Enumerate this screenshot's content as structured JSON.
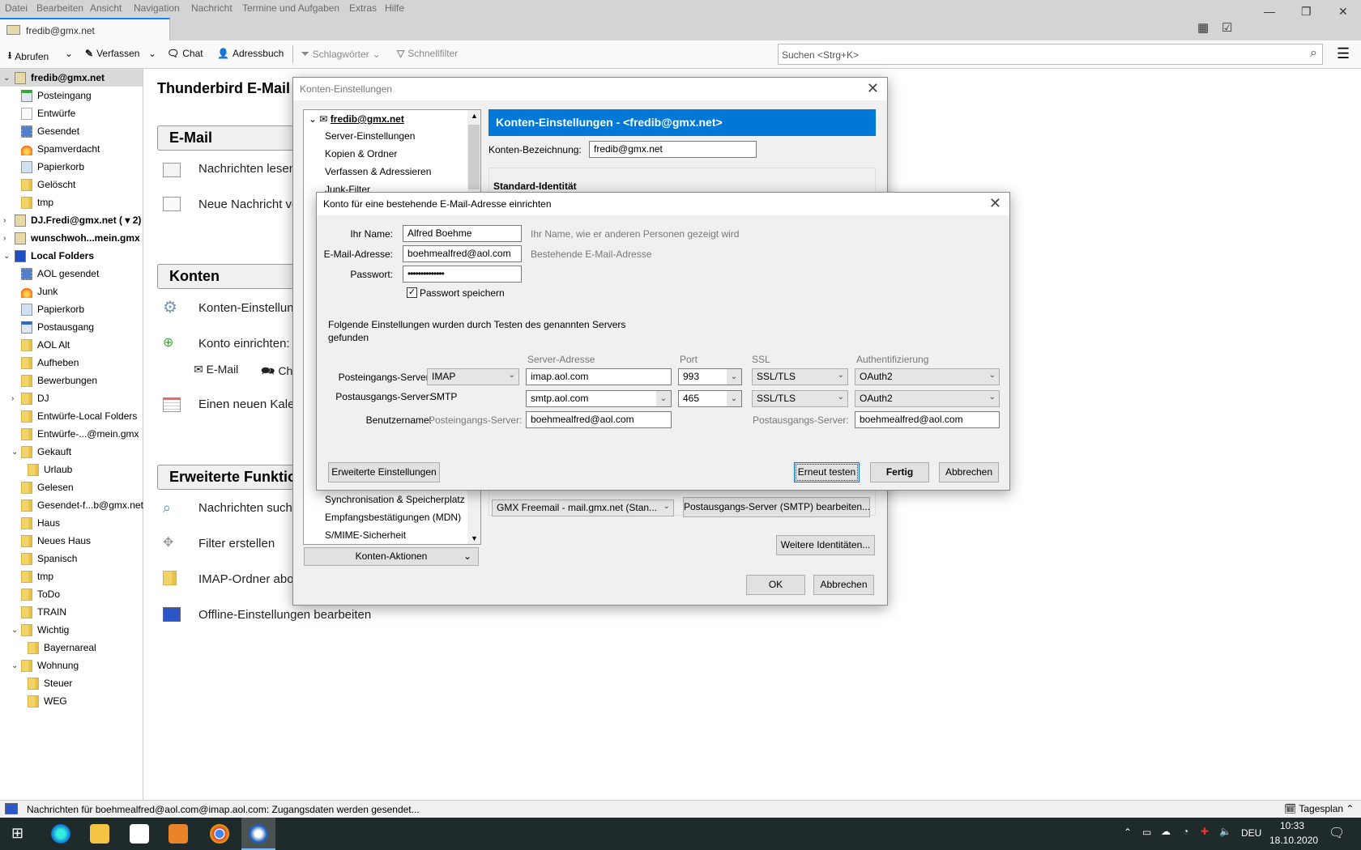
{
  "menu": [
    "Datei",
    "Bearbeiten",
    "Ansicht",
    "Navigation",
    "Nachricht",
    "Termine und Aufgaben",
    "Extras",
    "Hilfe"
  ],
  "tab": {
    "label": "fredib@gmx.net"
  },
  "toolbar": {
    "get": "Abrufen",
    "write": "Verfassen",
    "chat": "Chat",
    "addressbook": "Adressbuch",
    "tags": "Schlagwörter",
    "quickfilter": "Schnellfilter",
    "search_placeholder": "Suchen <Strg+K>"
  },
  "folders": [
    {
      "label": "fredib@gmx.net",
      "level": 0,
      "exp": "v",
      "icon": "account",
      "bold": true,
      "selected": true
    },
    {
      "label": "Posteingang",
      "level": 1,
      "icon": "inbox"
    },
    {
      "label": "Entwürfe",
      "level": 1,
      "icon": "drafts"
    },
    {
      "label": "Gesendet",
      "level": 1,
      "icon": "sent"
    },
    {
      "label": "Spamverdacht",
      "level": 1,
      "icon": "junk"
    },
    {
      "label": "Papierkorb",
      "level": 1,
      "icon": "trash"
    },
    {
      "label": "Gelöscht",
      "level": 1,
      "icon": "folder"
    },
    {
      "label": "tmp",
      "level": 1,
      "icon": "folder"
    },
    {
      "label": "DJ.Fredi@gmx.net ( ▾ 2)",
      "level": 0,
      "exp": ">",
      "icon": "account",
      "bold": true
    },
    {
      "label": "wunschwoh...mein.gmx",
      "level": 0,
      "exp": ">",
      "icon": "account",
      "bold": true
    },
    {
      "label": "Local Folders",
      "level": 0,
      "exp": "v",
      "icon": "computer",
      "bold": true
    },
    {
      "label": "AOL gesendet",
      "level": 1,
      "icon": "sent"
    },
    {
      "label": "Junk",
      "level": 1,
      "icon": "junk"
    },
    {
      "label": "Papierkorb",
      "level": 1,
      "icon": "trash"
    },
    {
      "label": "Postausgang",
      "level": 1,
      "icon": "outbox"
    },
    {
      "label": "AOL Alt",
      "level": 1,
      "icon": "folder"
    },
    {
      "label": "Aufheben",
      "level": 1,
      "icon": "folder"
    },
    {
      "label": "Bewerbungen",
      "level": 1,
      "icon": "folder"
    },
    {
      "label": "DJ",
      "level": 1,
      "exp": ">",
      "icon": "folder"
    },
    {
      "label": "Entwürfe-Local Folders",
      "level": 1,
      "icon": "folder"
    },
    {
      "label": "Entwürfe-...@mein.gmx",
      "level": 1,
      "icon": "folder"
    },
    {
      "label": "Gekauft",
      "level": 1,
      "exp": "v",
      "icon": "folder"
    },
    {
      "label": "Urlaub",
      "level": 2,
      "icon": "folder"
    },
    {
      "label": "Gelesen",
      "level": 1,
      "icon": "folder"
    },
    {
      "label": "Gesendet-f...b@gmx.net",
      "level": 1,
      "icon": "folder"
    },
    {
      "label": "Haus",
      "level": 1,
      "icon": "folder"
    },
    {
      "label": "Neues Haus",
      "level": 1,
      "icon": "folder"
    },
    {
      "label": "Spanisch",
      "level": 1,
      "icon": "folder"
    },
    {
      "label": "tmp",
      "level": 1,
      "icon": "folder"
    },
    {
      "label": "ToDo",
      "level": 1,
      "icon": "folder"
    },
    {
      "label": "TRAIN",
      "level": 1,
      "icon": "folder"
    },
    {
      "label": "Wichtig",
      "level": 1,
      "exp": "v",
      "icon": "folder"
    },
    {
      "label": "Bayernareal",
      "level": 2,
      "icon": "folder"
    },
    {
      "label": "Wohnung",
      "level": 1,
      "exp": "v",
      "icon": "folder"
    },
    {
      "label": "Steuer",
      "level": 2,
      "icon": "folder"
    },
    {
      "label": "WEG",
      "level": 2,
      "icon": "folder"
    }
  ],
  "main": {
    "title": "Thunderbird E-Mail - fredib@gmx.net",
    "sections": {
      "email": "E-Mail",
      "accounts": "Konten",
      "advanced": "Erweiterte Funktionen"
    },
    "items": {
      "read": "Nachrichten lesen",
      "compose": "Neue Nachricht verfassen",
      "settings": "Konten-Einstellungen",
      "setup": "Konto einrichten:",
      "setup_email": "E-Mail",
      "setup_chat": "Chat",
      "calendar": "Einen neuen Kalender erstellen",
      "search": "Nachrichten suchen",
      "filter": "Filter erstellen",
      "imap": "IMAP-Ordner abonnieren",
      "offline": "Offline-Einstellungen bearbeiten"
    }
  },
  "account_settings": {
    "title": "Konten-Einstellungen",
    "tree": {
      "account": "fredib@gmx.net",
      "items": [
        "Server-Einstellungen",
        "Kopien & Ordner",
        "Verfassen & Adressieren",
        "Junk-Filter"
      ],
      "items_bottom": [
        "Synchronisation & Speicherplatz",
        "Empfangsbestätigungen (MDN)",
        "S/MIME-Sicherheit"
      ]
    },
    "header": "Konten-Einstellungen - <fredib@gmx.net>",
    "name_label": "Konten-Bezeichnung:",
    "name_value": "fredib@gmx.net",
    "identity_heading": "Standard-Identität",
    "smtp_select": "GMX Freemail - mail.gmx.net (Stan...",
    "smtp_edit": "Postausgangs-Server (SMTP) bearbeiten...",
    "more_identities": "Weitere Identitäten...",
    "actions": "Konten-Aktionen",
    "ok": "OK",
    "cancel": "Abbrechen"
  },
  "setup_dialog": {
    "title": "Konto für eine bestehende E-Mail-Adresse einrichten",
    "name_label": "Ihr Name:",
    "name_value": "Alfred Boehme",
    "name_hint": "Ihr Name, wie er anderen Personen gezeigt wird",
    "email_label": "E-Mail-Adresse:",
    "email_value": "boehmealfred@aol.com",
    "email_hint": "Bestehende E-Mail-Adresse",
    "password_label": "Passwort:",
    "password_value": "••••••••••••••",
    "remember_label": "Passwort speichern",
    "remember_checked": true,
    "info_line1": "Folgende Einstellungen wurden durch Testen des genannten Servers",
    "info_line2": "gefunden",
    "col_server": "Server-Adresse",
    "col_port": "Port",
    "col_ssl": "SSL",
    "col_auth": "Authentifizierung",
    "incoming": {
      "label": "Posteingangs-Server:",
      "protocol": "IMAP",
      "server": "imap.aol.com",
      "port": "993",
      "ssl": "SSL/TLS",
      "auth": "OAuth2"
    },
    "outgoing": {
      "label": "Postausgangs-Server:",
      "protocol": "SMTP",
      "server": "smtp.aol.com",
      "port": "465",
      "ssl": "SSL/TLS",
      "auth": "OAuth2"
    },
    "username_label": "Benutzername:",
    "username_in_label": "Posteingangs-Server:",
    "username_in": "boehmealfred@aol.com",
    "username_out_label": "Postausgangs-Server:",
    "username_out": "boehmealfred@aol.com",
    "advanced": "Erweiterte Einstellungen",
    "retest": "Erneut testen",
    "done": "Fertig",
    "cancel": "Abbrechen"
  },
  "status": {
    "text": "Nachrichten für boehmealfred@aol.com@imap.aol.com: Zugangsdaten werden gesendet...",
    "today_pane": "Tagesplan"
  },
  "taskbar": {
    "lang": "DEU",
    "time": "10:33",
    "date": "18.10.2020"
  }
}
